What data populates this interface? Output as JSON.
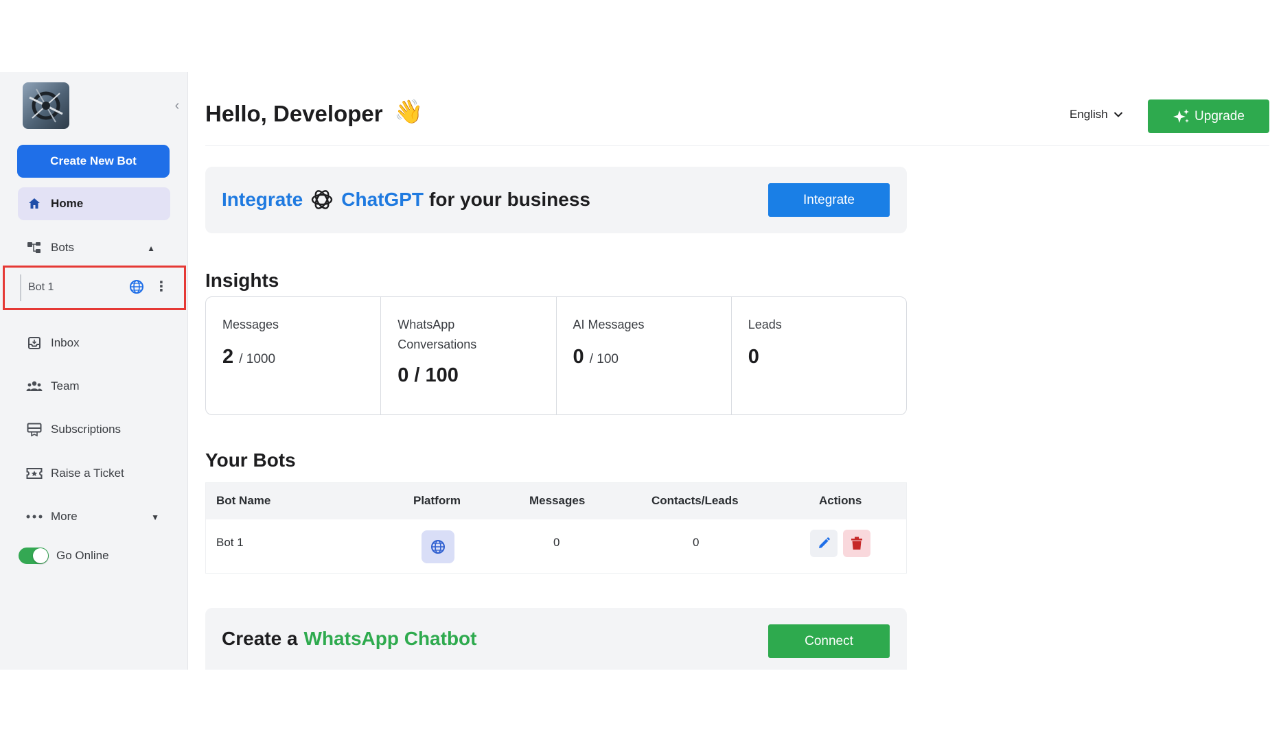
{
  "sidebar": {
    "create_button": "Create New Bot",
    "items": [
      {
        "label": "Home",
        "icon": "home-icon"
      },
      {
        "label": "Bots",
        "icon": "bots-icon"
      },
      {
        "label": "Inbox",
        "icon": "inbox-icon"
      },
      {
        "label": "Team",
        "icon": "team-icon"
      },
      {
        "label": "Subscriptions",
        "icon": "subscriptions-icon"
      },
      {
        "label": "Raise a Ticket",
        "icon": "ticket-icon"
      },
      {
        "label": "More",
        "icon": "more-icon"
      }
    ],
    "bot_entry": "Bot 1",
    "go_online_label": "Go Online",
    "go_online_enabled": true
  },
  "header": {
    "greeting": "Hello, Developer",
    "wave_emoji": "👋",
    "language": "English",
    "upgrade_label": "Upgrade"
  },
  "integrate_banner": {
    "word1": "Integrate",
    "word2": "ChatGPT",
    "word3": "for your business",
    "button": "Integrate"
  },
  "insights": {
    "title": "Insights",
    "metrics": [
      {
        "label": "Messages",
        "value": "2",
        "suffix": "/ 1000"
      },
      {
        "label": "WhatsApp Conversations",
        "value": "0 / 100",
        "suffix": ""
      },
      {
        "label": "AI Messages",
        "value": "0",
        "suffix": "/ 100"
      },
      {
        "label": "Leads",
        "value": "0",
        "suffix": ""
      }
    ]
  },
  "bots_table": {
    "title": "Your Bots",
    "columns": [
      "Bot Name",
      "Platform",
      "Messages",
      "Contacts/Leads",
      "Actions"
    ],
    "rows": [
      {
        "name": "Bot 1",
        "platform": "web",
        "messages": "0",
        "contacts": "0"
      }
    ]
  },
  "whatsapp_banner": {
    "prefix": "Create a",
    "highlight": "WhatsApp Chatbot",
    "button": "Connect"
  },
  "colors": {
    "primary_blue": "#1f6fe8",
    "green": "#2eaa4e",
    "highlight_red": "#e53935"
  }
}
